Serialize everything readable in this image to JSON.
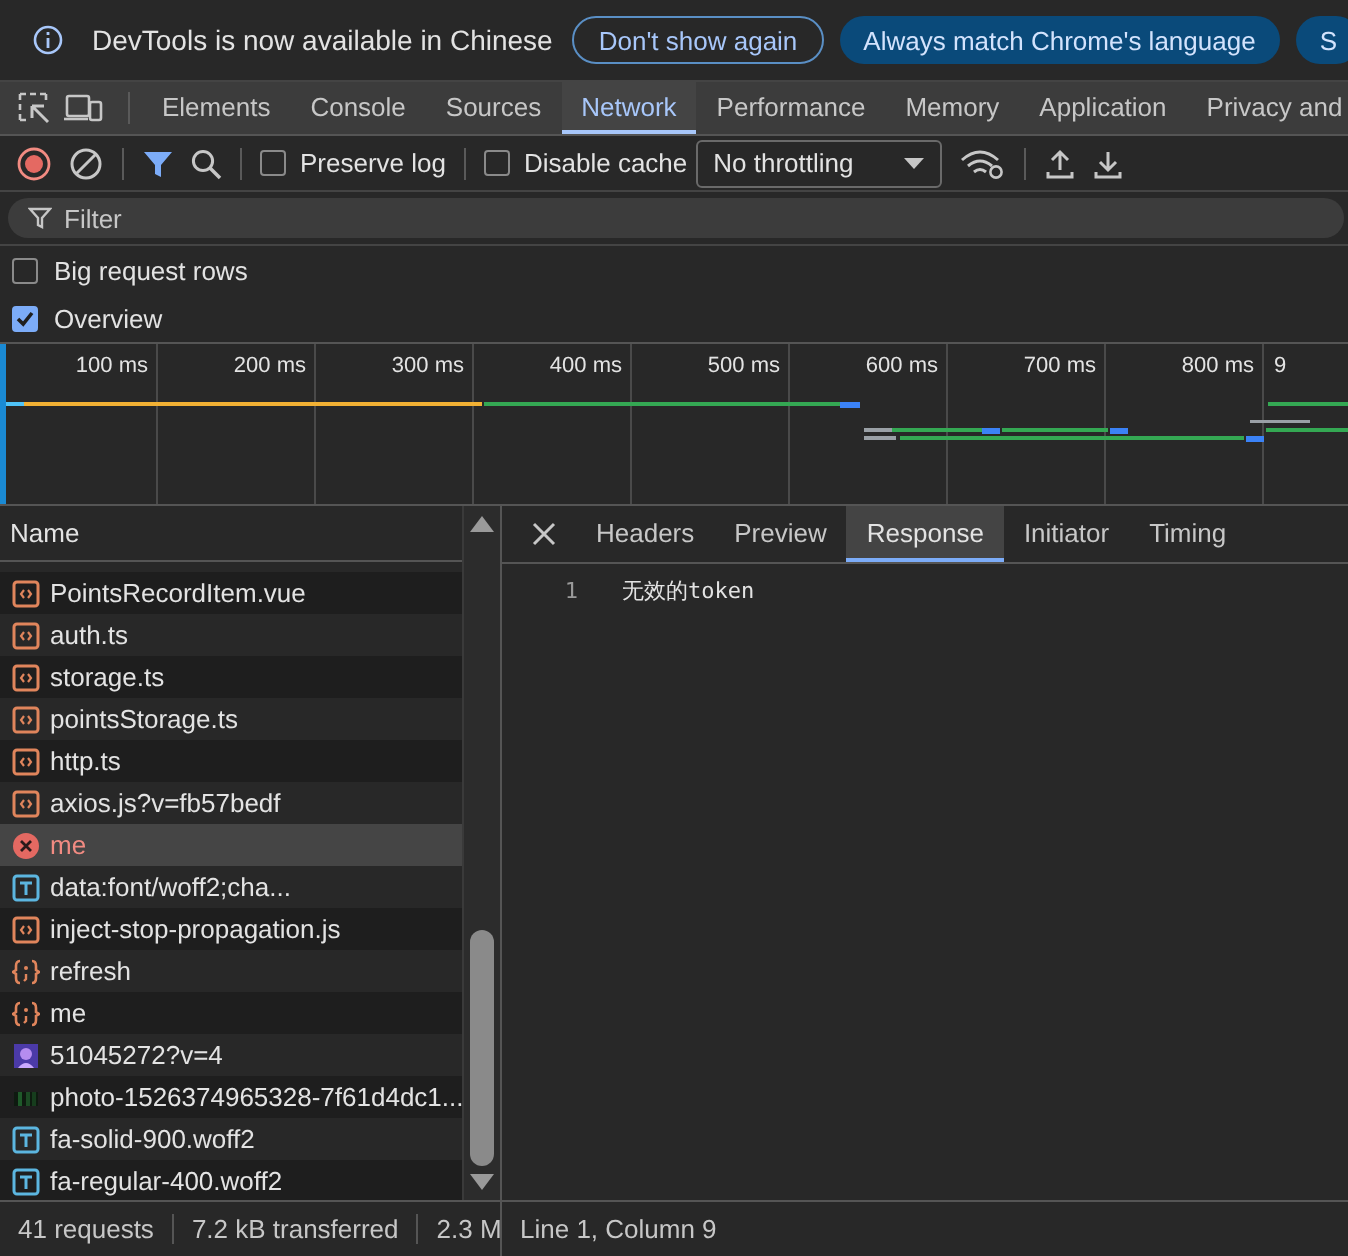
{
  "infobar": {
    "message": "DevTools is now available in Chinese",
    "buttons": [
      {
        "label": "Don't show again",
        "kind": "outline"
      },
      {
        "label": "Always match Chrome's language",
        "kind": "filled"
      },
      {
        "label": "S",
        "kind": "filled"
      }
    ]
  },
  "panel_tabs": [
    {
      "label": "Elements",
      "selected": false
    },
    {
      "label": "Console",
      "selected": false
    },
    {
      "label": "Sources",
      "selected": false
    },
    {
      "label": "Network",
      "selected": true
    },
    {
      "label": "Performance",
      "selected": false
    },
    {
      "label": "Memory",
      "selected": false
    },
    {
      "label": "Application",
      "selected": false
    },
    {
      "label": "Privacy and",
      "selected": false
    }
  ],
  "toolbar": {
    "preserve_log": {
      "label": "Preserve log",
      "checked": false
    },
    "disable_cache": {
      "label": "Disable cache",
      "checked": false
    },
    "throttling": "No throttling"
  },
  "filter": {
    "placeholder": "Filter"
  },
  "options": [
    {
      "label": "Big request rows",
      "checked": false
    },
    {
      "label": "Overview",
      "checked": true
    }
  ],
  "overview": {
    "ticks": [
      "100 ms",
      "200 ms",
      "300 ms",
      "400 ms",
      "500 ms",
      "600 ms",
      "700 ms",
      "800 ms",
      "9"
    ]
  },
  "requests": {
    "column": "Name",
    "rows": [
      {
        "name": "PointsRecordItem.vue",
        "kind": "script",
        "selected": false
      },
      {
        "name": "auth.ts",
        "kind": "script",
        "selected": false
      },
      {
        "name": "storage.ts",
        "kind": "script",
        "selected": false
      },
      {
        "name": "pointsStorage.ts",
        "kind": "script",
        "selected": false
      },
      {
        "name": "http.ts",
        "kind": "script",
        "selected": false
      },
      {
        "name": "axios.js?v=fb57bedf",
        "kind": "script",
        "selected": false
      },
      {
        "name": "me",
        "kind": "error",
        "selected": true
      },
      {
        "name": "data:font/woff2;cha...",
        "kind": "font",
        "selected": false
      },
      {
        "name": "inject-stop-propagation.js",
        "kind": "script",
        "selected": false
      },
      {
        "name": "refresh",
        "kind": "fetch",
        "selected": false
      },
      {
        "name": "me",
        "kind": "fetch",
        "selected": false
      },
      {
        "name": "51045272?v=4",
        "kind": "image",
        "selected": false
      },
      {
        "name": "photo-1526374965328-7f61d4dc1...",
        "kind": "photo",
        "selected": false
      },
      {
        "name": "fa-solid-900.woff2",
        "kind": "font",
        "selected": false
      },
      {
        "name": "fa-regular-400.woff2",
        "kind": "font",
        "selected": false
      }
    ]
  },
  "detail_tabs": [
    {
      "label": "Headers",
      "selected": false
    },
    {
      "label": "Preview",
      "selected": false
    },
    {
      "label": "Response",
      "selected": true
    },
    {
      "label": "Initiator",
      "selected": false
    },
    {
      "label": "Timing",
      "selected": false
    }
  ],
  "response": {
    "lines": [
      {
        "number": "1",
        "text": "无效的token"
      }
    ]
  },
  "status_bar": {
    "items": [
      "41 requests",
      "7.2 kB transferred",
      "2.3 M"
    ],
    "cursor": "Line 1, Column 9"
  }
}
